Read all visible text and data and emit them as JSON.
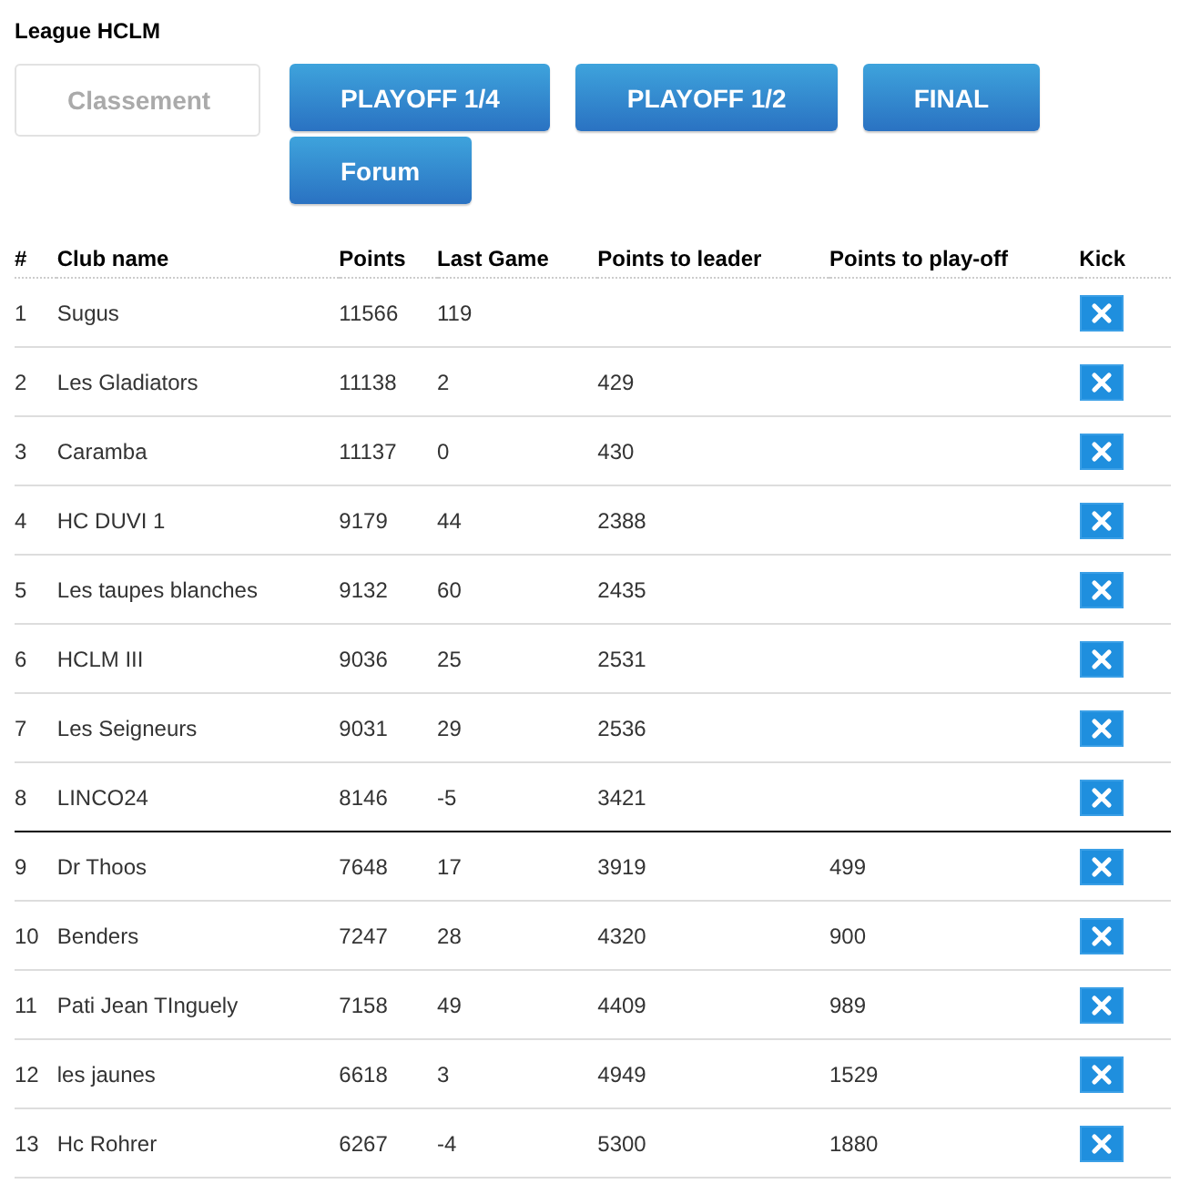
{
  "title": "League HCLM",
  "tabs": [
    {
      "label": "Classement",
      "selected": true
    },
    {
      "label": "PLAYOFF 1/4",
      "selected": false
    },
    {
      "label": "PLAYOFF 1/2",
      "selected": false
    },
    {
      "label": "FINAL",
      "selected": false
    },
    {
      "label": "Forum",
      "selected": false
    }
  ],
  "table": {
    "columns": [
      "#",
      "Club name",
      "Points",
      "Last Game",
      "Points to leader",
      "Points to play-off",
      "Kick"
    ],
    "rows": [
      {
        "rank": "1",
        "club": "Sugus",
        "points": "11566",
        "last_game": "119",
        "to_leader": "",
        "to_playoff": "",
        "cutoff_below": false
      },
      {
        "rank": "2",
        "club": "Les Gladiators",
        "points": "11138",
        "last_game": "2",
        "to_leader": "429",
        "to_playoff": "",
        "cutoff_below": false
      },
      {
        "rank": "3",
        "club": "Caramba",
        "points": "11137",
        "last_game": "0",
        "to_leader": "430",
        "to_playoff": "",
        "cutoff_below": false
      },
      {
        "rank": "4",
        "club": "HC DUVI 1",
        "points": "9179",
        "last_game": "44",
        "to_leader": "2388",
        "to_playoff": "",
        "cutoff_below": false
      },
      {
        "rank": "5",
        "club": "Les taupes blanches",
        "points": "9132",
        "last_game": "60",
        "to_leader": "2435",
        "to_playoff": "",
        "cutoff_below": false
      },
      {
        "rank": "6",
        "club": "HCLM III",
        "points": "9036",
        "last_game": "25",
        "to_leader": "2531",
        "to_playoff": "",
        "cutoff_below": false
      },
      {
        "rank": "7",
        "club": "Les Seigneurs",
        "points": "9031",
        "last_game": "29",
        "to_leader": "2536",
        "to_playoff": "",
        "cutoff_below": false
      },
      {
        "rank": "8",
        "club": "LINCO24",
        "points": "8146",
        "last_game": "-5",
        "to_leader": "3421",
        "to_playoff": "",
        "cutoff_below": true
      },
      {
        "rank": "9",
        "club": "Dr Thoos",
        "points": "7648",
        "last_game": "17",
        "to_leader": "3919",
        "to_playoff": "499",
        "cutoff_below": false
      },
      {
        "rank": "10",
        "club": "Benders",
        "points": "7247",
        "last_game": "28",
        "to_leader": "4320",
        "to_playoff": "900",
        "cutoff_below": false
      },
      {
        "rank": "11",
        "club": "Pati Jean TInguely",
        "points": "7158",
        "last_game": "49",
        "to_leader": "4409",
        "to_playoff": "989",
        "cutoff_below": false
      },
      {
        "rank": "12",
        "club": "les jaunes",
        "points": "6618",
        "last_game": "3",
        "to_leader": "4949",
        "to_playoff": "1529",
        "cutoff_below": false
      },
      {
        "rank": "13",
        "club": "Hc Rohrer",
        "points": "6267",
        "last_game": "-4",
        "to_leader": "5300",
        "to_playoff": "1880",
        "cutoff_below": false
      }
    ]
  }
}
